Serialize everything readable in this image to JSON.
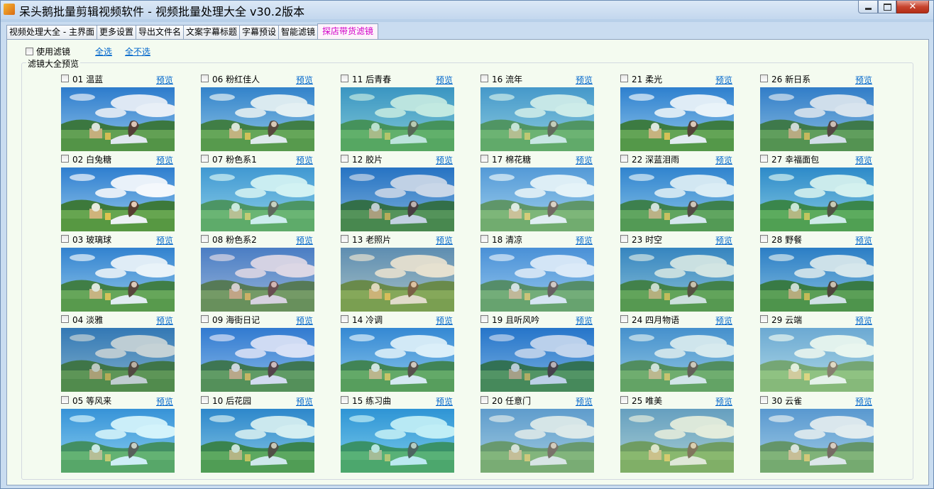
{
  "window": {
    "title": "呆头鹅批量剪辑视频软件 -  视频批量处理大全  v30.2版本"
  },
  "tabs": [
    {
      "label": "视频处理大全 - 主界面",
      "active": false
    },
    {
      "label": "更多设置",
      "active": false
    },
    {
      "label": "导出文件名",
      "active": false
    },
    {
      "label": "文案字幕标题",
      "active": false
    },
    {
      "label": "字幕预设",
      "active": false
    },
    {
      "label": "智能滤镜",
      "active": false
    },
    {
      "label": "探店带货滤镜",
      "active": true
    }
  ],
  "options": {
    "use_filter_label": "使用滤镜",
    "select_all_label": "全选",
    "select_none_label": "全不选"
  },
  "group": {
    "label": "滤镜大全预览"
  },
  "preview_label": "预览",
  "filters": [
    {
      "name": "01 温蓝",
      "tint": "#1a5fb0",
      "opacity": 0.1
    },
    {
      "name": "02 白兔糖",
      "tint": "#2a78c8",
      "opacity": 0.05
    },
    {
      "name": "03 玻璃球",
      "tint": "#4a9ad0",
      "opacity": 0.12
    },
    {
      "name": "04 淡雅",
      "tint": "#3e6a78",
      "opacity": 0.3
    },
    {
      "name": "05 等风来",
      "tint": "#4fd0f0",
      "opacity": 0.25
    },
    {
      "name": "06 粉红佳人",
      "tint": "#4a9ab0",
      "opacity": 0.15
    },
    {
      "name": "07 粉色系1",
      "tint": "#6ad4d8",
      "opacity": 0.3
    },
    {
      "name": "08 粉色系2",
      "tint": "#8a7aa8",
      "opacity": 0.3
    },
    {
      "name": "09 海街日记",
      "tint": "#3a6ad0",
      "opacity": 0.2
    },
    {
      "name": "10 后花园",
      "tint": "#2aa8b8",
      "opacity": 0.2
    },
    {
      "name": "11 后青春",
      "tint": "#50c0a8",
      "opacity": 0.35
    },
    {
      "name": "12 胶片",
      "tint": "#0a4a98",
      "opacity": 0.22
    },
    {
      "name": "13 老照片",
      "tint": "#b8a878",
      "opacity": 0.35
    },
    {
      "name": "14 冷调",
      "tint": "#4ab0e0",
      "opacity": 0.2
    },
    {
      "name": "15 练习曲",
      "tint": "#30c8e0",
      "opacity": 0.3
    },
    {
      "name": "16 流年",
      "tint": "#70c8c0",
      "opacity": 0.35
    },
    {
      "name": "17 棉花糖",
      "tint": "#a8d8e8",
      "opacity": 0.3
    },
    {
      "name": "18 清凉",
      "tint": "#88b8e8",
      "opacity": 0.3
    },
    {
      "name": "19 且听风吟",
      "tint": "#0a58b8",
      "opacity": 0.25
    },
    {
      "name": "20 任意门",
      "tint": "#a8c8c8",
      "opacity": 0.4
    },
    {
      "name": "21 柔光",
      "tint": "#2a88c8",
      "opacity": 0.1
    },
    {
      "name": "22 深蓝泪雨",
      "tint": "#3a9ac8",
      "opacity": 0.18
    },
    {
      "name": "23 时空",
      "tint": "#4a9890",
      "opacity": 0.25
    },
    {
      "name": "24 四月物语",
      "tint": "#7ab8c8",
      "opacity": 0.3
    },
    {
      "name": "25 唯美",
      "tint": "#b8d0a8",
      "opacity": 0.4
    },
    {
      "name": "26 新日系",
      "tint": "#3a78a8",
      "opacity": 0.2
    },
    {
      "name": "27 幸福面包",
      "tint": "#2ab8b0",
      "opacity": 0.2
    },
    {
      "name": "28 野餐",
      "tint": "#1a7a98",
      "opacity": 0.18
    },
    {
      "name": "29 云端",
      "tint": "#c8e8d8",
      "opacity": 0.4
    },
    {
      "name": "30 云雀",
      "tint": "#a8c8d0",
      "opacity": 0.35
    }
  ],
  "colors": {
    "active_tab_text": "#d200c8",
    "link": "#0066cc",
    "panel_bg": "#f4fbf0"
  }
}
